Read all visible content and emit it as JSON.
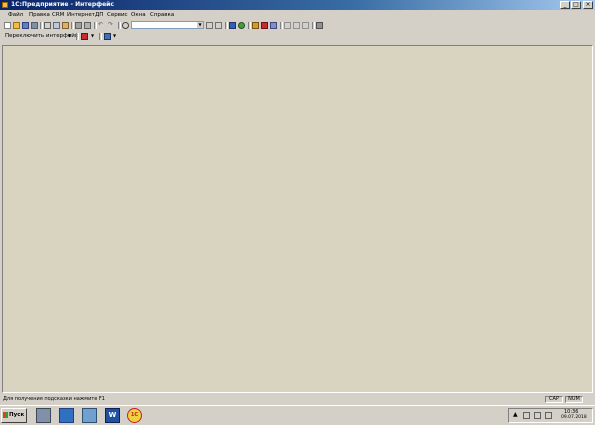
{
  "window": {
    "title": "1С:Предприятие - Интерфейс",
    "colors": {
      "titlebar": "#0a246a",
      "workspace": "#d8d4c0",
      "chrome": "#d4d0c8"
    }
  },
  "menu": [
    {
      "label": "Файл"
    },
    {
      "label": "Правка"
    },
    {
      "label": "CRM"
    },
    {
      "label": "Интернет"
    },
    {
      "label": "ДП"
    },
    {
      "label": "Сервис"
    },
    {
      "label": "Окна"
    },
    {
      "label": "Справка"
    }
  ],
  "toolbar2": {
    "switch_interface_label": "Переключить интерфейс"
  },
  "search": {
    "value": ""
  },
  "status": {
    "hint": "Для получения подсказки нажмите F1",
    "cap": "CAP",
    "num": "NUM"
  },
  "taskbar": {
    "start_label": "Пуск",
    "time": "10:36",
    "date": "09.07.2018",
    "apps": [
      {
        "icon": "computer-icon"
      },
      {
        "icon": "photo-icon"
      },
      {
        "icon": "image-viewer-icon"
      },
      {
        "icon": "word-icon"
      },
      {
        "icon": "1c-icon"
      }
    ]
  }
}
